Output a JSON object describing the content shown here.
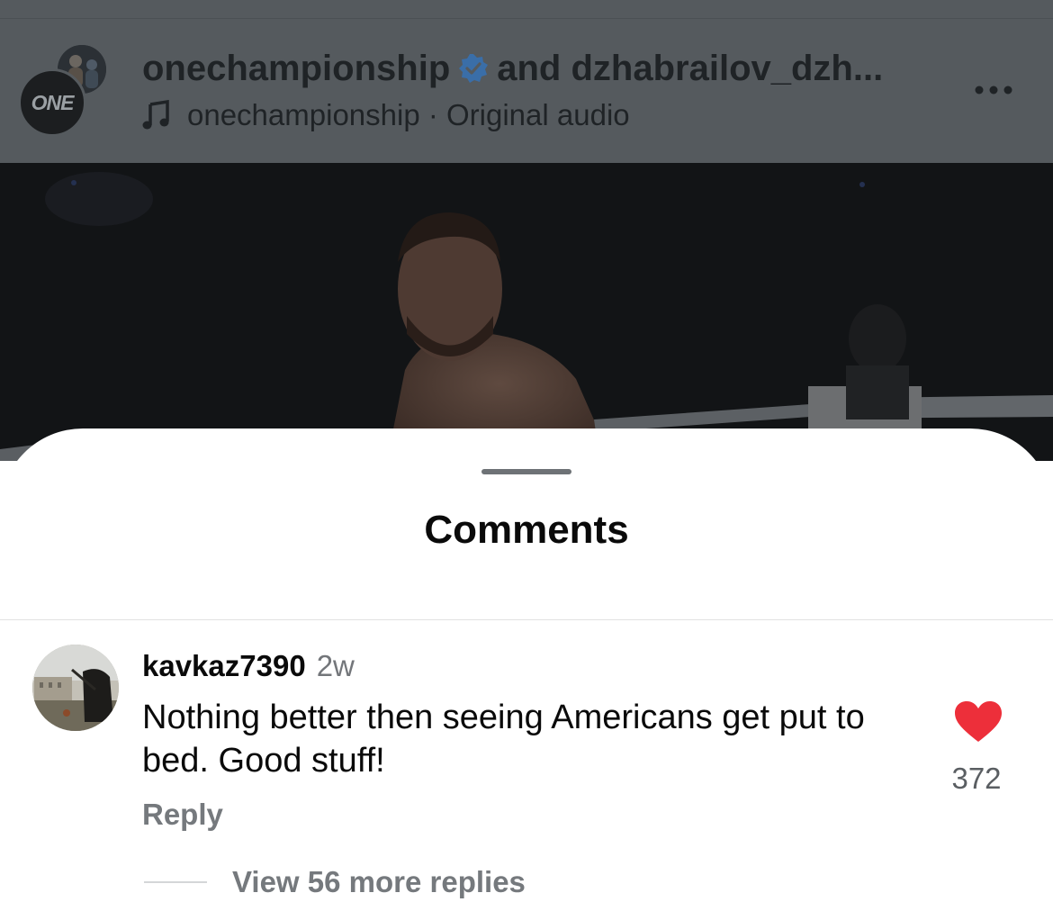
{
  "post_header": {
    "account": "onechampionship",
    "coauthor_text": "and dzhabrailov_dzh...",
    "audio": "onechampionship · Original audio",
    "logo_text": "ONE",
    "icons": {
      "verified": "verified-badge-icon",
      "audio": "music-note-icon",
      "more": "more-options-icon"
    }
  },
  "sheet": {
    "title": "Comments"
  },
  "comment": {
    "username": "kavkaz7390",
    "time": "2w",
    "text": "Nothing better then seeing Americans get put to bed. Good stuff!",
    "reply_label": "Reply",
    "like_count": "372",
    "liked": true,
    "view_replies_label": "View 56 more replies"
  },
  "colors": {
    "like": "#ed2f3a",
    "verified": "#3a6ea8",
    "header_overlay": "#555a5e"
  }
}
